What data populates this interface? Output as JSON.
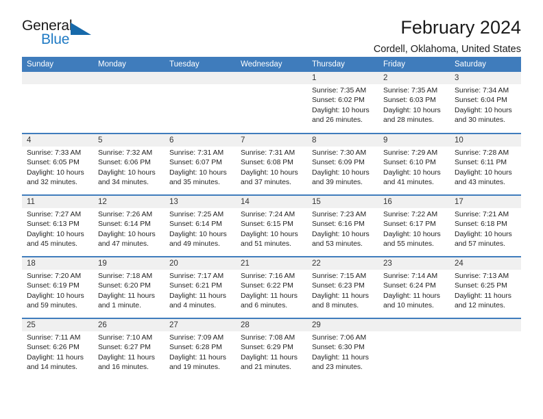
{
  "brand": {
    "name_top": "General",
    "name_bottom": "Blue",
    "flag_icon": "blue-triangle-flag-icon",
    "accent_color": "#1f7ac4"
  },
  "header": {
    "title": "February 2024",
    "subtitle": "Cordell, Oklahoma, United States"
  },
  "theme": {
    "header_blue": "#3f7cbc",
    "daynum_gray": "#f0f0f0"
  },
  "calendar": {
    "weekday_headers": [
      "Sunday",
      "Monday",
      "Tuesday",
      "Wednesday",
      "Thursday",
      "Friday",
      "Saturday"
    ],
    "weeks": [
      [
        {
          "day": "",
          "sunrise": "",
          "sunset": "",
          "daylight": "",
          "empty": true
        },
        {
          "day": "",
          "sunrise": "",
          "sunset": "",
          "daylight": "",
          "empty": true
        },
        {
          "day": "",
          "sunrise": "",
          "sunset": "",
          "daylight": "",
          "empty": true
        },
        {
          "day": "",
          "sunrise": "",
          "sunset": "",
          "daylight": "",
          "empty": true
        },
        {
          "day": "1",
          "sunrise": "Sunrise: 7:35 AM",
          "sunset": "Sunset: 6:02 PM",
          "daylight": "Daylight: 10 hours and 26 minutes."
        },
        {
          "day": "2",
          "sunrise": "Sunrise: 7:35 AM",
          "sunset": "Sunset: 6:03 PM",
          "daylight": "Daylight: 10 hours and 28 minutes."
        },
        {
          "day": "3",
          "sunrise": "Sunrise: 7:34 AM",
          "sunset": "Sunset: 6:04 PM",
          "daylight": "Daylight: 10 hours and 30 minutes."
        }
      ],
      [
        {
          "day": "4",
          "sunrise": "Sunrise: 7:33 AM",
          "sunset": "Sunset: 6:05 PM",
          "daylight": "Daylight: 10 hours and 32 minutes."
        },
        {
          "day": "5",
          "sunrise": "Sunrise: 7:32 AM",
          "sunset": "Sunset: 6:06 PM",
          "daylight": "Daylight: 10 hours and 34 minutes."
        },
        {
          "day": "6",
          "sunrise": "Sunrise: 7:31 AM",
          "sunset": "Sunset: 6:07 PM",
          "daylight": "Daylight: 10 hours and 35 minutes."
        },
        {
          "day": "7",
          "sunrise": "Sunrise: 7:31 AM",
          "sunset": "Sunset: 6:08 PM",
          "daylight": "Daylight: 10 hours and 37 minutes."
        },
        {
          "day": "8",
          "sunrise": "Sunrise: 7:30 AM",
          "sunset": "Sunset: 6:09 PM",
          "daylight": "Daylight: 10 hours and 39 minutes."
        },
        {
          "day": "9",
          "sunrise": "Sunrise: 7:29 AM",
          "sunset": "Sunset: 6:10 PM",
          "daylight": "Daylight: 10 hours and 41 minutes."
        },
        {
          "day": "10",
          "sunrise": "Sunrise: 7:28 AM",
          "sunset": "Sunset: 6:11 PM",
          "daylight": "Daylight: 10 hours and 43 minutes."
        }
      ],
      [
        {
          "day": "11",
          "sunrise": "Sunrise: 7:27 AM",
          "sunset": "Sunset: 6:13 PM",
          "daylight": "Daylight: 10 hours and 45 minutes."
        },
        {
          "day": "12",
          "sunrise": "Sunrise: 7:26 AM",
          "sunset": "Sunset: 6:14 PM",
          "daylight": "Daylight: 10 hours and 47 minutes."
        },
        {
          "day": "13",
          "sunrise": "Sunrise: 7:25 AM",
          "sunset": "Sunset: 6:14 PM",
          "daylight": "Daylight: 10 hours and 49 minutes."
        },
        {
          "day": "14",
          "sunrise": "Sunrise: 7:24 AM",
          "sunset": "Sunset: 6:15 PM",
          "daylight": "Daylight: 10 hours and 51 minutes."
        },
        {
          "day": "15",
          "sunrise": "Sunrise: 7:23 AM",
          "sunset": "Sunset: 6:16 PM",
          "daylight": "Daylight: 10 hours and 53 minutes."
        },
        {
          "day": "16",
          "sunrise": "Sunrise: 7:22 AM",
          "sunset": "Sunset: 6:17 PM",
          "daylight": "Daylight: 10 hours and 55 minutes."
        },
        {
          "day": "17",
          "sunrise": "Sunrise: 7:21 AM",
          "sunset": "Sunset: 6:18 PM",
          "daylight": "Daylight: 10 hours and 57 minutes."
        }
      ],
      [
        {
          "day": "18",
          "sunrise": "Sunrise: 7:20 AM",
          "sunset": "Sunset: 6:19 PM",
          "daylight": "Daylight: 10 hours and 59 minutes."
        },
        {
          "day": "19",
          "sunrise": "Sunrise: 7:18 AM",
          "sunset": "Sunset: 6:20 PM",
          "daylight": "Daylight: 11 hours and 1 minute."
        },
        {
          "day": "20",
          "sunrise": "Sunrise: 7:17 AM",
          "sunset": "Sunset: 6:21 PM",
          "daylight": "Daylight: 11 hours and 4 minutes."
        },
        {
          "day": "21",
          "sunrise": "Sunrise: 7:16 AM",
          "sunset": "Sunset: 6:22 PM",
          "daylight": "Daylight: 11 hours and 6 minutes."
        },
        {
          "day": "22",
          "sunrise": "Sunrise: 7:15 AM",
          "sunset": "Sunset: 6:23 PM",
          "daylight": "Daylight: 11 hours and 8 minutes."
        },
        {
          "day": "23",
          "sunrise": "Sunrise: 7:14 AM",
          "sunset": "Sunset: 6:24 PM",
          "daylight": "Daylight: 11 hours and 10 minutes."
        },
        {
          "day": "24",
          "sunrise": "Sunrise: 7:13 AM",
          "sunset": "Sunset: 6:25 PM",
          "daylight": "Daylight: 11 hours and 12 minutes."
        }
      ],
      [
        {
          "day": "25",
          "sunrise": "Sunrise: 7:11 AM",
          "sunset": "Sunset: 6:26 PM",
          "daylight": "Daylight: 11 hours and 14 minutes."
        },
        {
          "day": "26",
          "sunrise": "Sunrise: 7:10 AM",
          "sunset": "Sunset: 6:27 PM",
          "daylight": "Daylight: 11 hours and 16 minutes."
        },
        {
          "day": "27",
          "sunrise": "Sunrise: 7:09 AM",
          "sunset": "Sunset: 6:28 PM",
          "daylight": "Daylight: 11 hours and 19 minutes."
        },
        {
          "day": "28",
          "sunrise": "Sunrise: 7:08 AM",
          "sunset": "Sunset: 6:29 PM",
          "daylight": "Daylight: 11 hours and 21 minutes."
        },
        {
          "day": "29",
          "sunrise": "Sunrise: 7:06 AM",
          "sunset": "Sunset: 6:30 PM",
          "daylight": "Daylight: 11 hours and 23 minutes."
        },
        {
          "day": "",
          "sunrise": "",
          "sunset": "",
          "daylight": "",
          "empty": true
        },
        {
          "day": "",
          "sunrise": "",
          "sunset": "",
          "daylight": "",
          "empty": true
        }
      ]
    ]
  }
}
